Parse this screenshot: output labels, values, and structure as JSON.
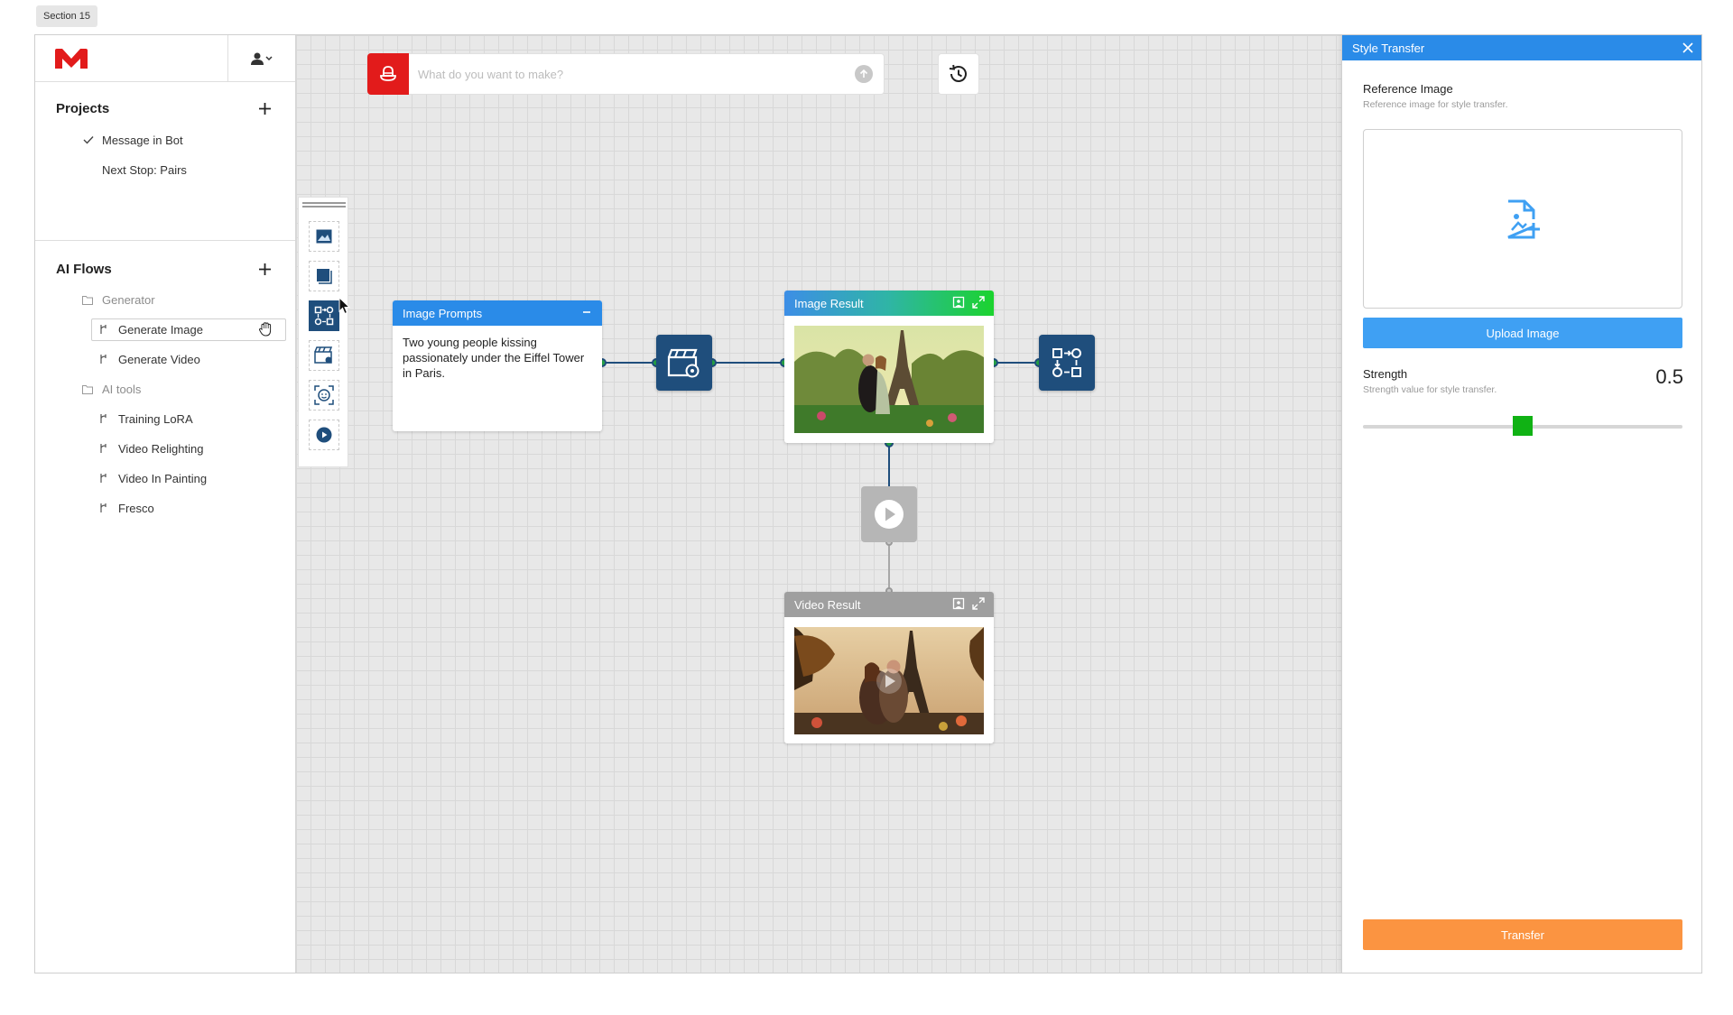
{
  "section_tag": "Section 15",
  "colors": {
    "brand": "#e21b1b",
    "accent": "#2a8be8",
    "node": "#1f4e7c",
    "success": "#10b214",
    "cta": "#fb9441"
  },
  "sidebar": {
    "projects_title": "Projects",
    "projects": [
      {
        "label": "Message in Bot",
        "checked": true
      },
      {
        "label": "Next Stop: Pairs",
        "checked": false
      }
    ],
    "flows_title": "AI Flows",
    "groups": [
      {
        "label": "Generator",
        "items": [
          "Generate Image",
          "Generate Video"
        ]
      },
      {
        "label": "AI tools",
        "items": [
          "Training LoRA",
          "Video Relighting",
          "Video In Painting",
          "Fresco"
        ]
      }
    ],
    "active_item": "Generate Image"
  },
  "canvas": {
    "prompt_placeholder": "What do you want to make?",
    "prompts_card": {
      "title": "Image Prompts",
      "text": "Two young people kissing passionately under the Eiffel Tower in Paris."
    },
    "image_card": {
      "title": "Image Result"
    },
    "video_card": {
      "title": "Video Result"
    }
  },
  "panel": {
    "title": "Style Transfer",
    "ref_label": "Reference Image",
    "ref_help": "Reference image for style transfer.",
    "upload_label": "Upload Image",
    "strength_label": "Strength",
    "strength_help": "Strength value for style transfer.",
    "strength_value": "0.5",
    "strength_fraction": 0.5,
    "transfer_label": "Transfer"
  }
}
